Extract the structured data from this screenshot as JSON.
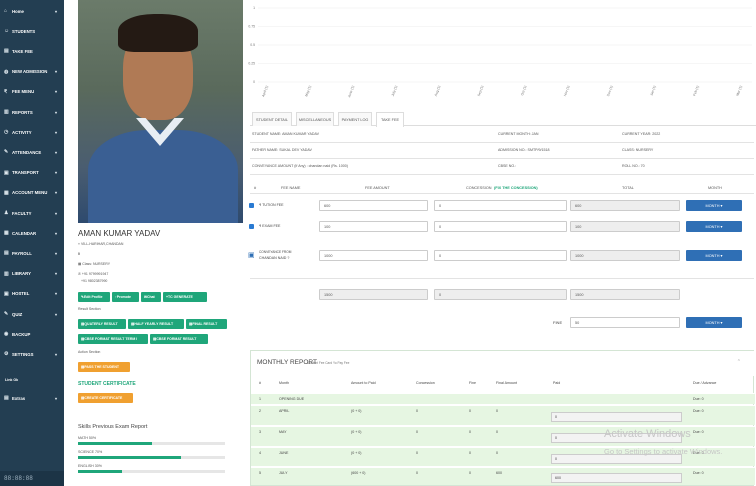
{
  "sidebar": {
    "items": [
      {
        "label": "Home",
        "icon": "home-icon",
        "glyph": "⌂",
        "arrow": true
      },
      {
        "label": "STUDENTS",
        "icon": "users-icon",
        "glyph": "☺",
        "arrow": false
      },
      {
        "label": "TAKE FEE",
        "icon": "fee-icon",
        "glyph": "▤",
        "arrow": false
      },
      {
        "label": "NEW ADMISSION",
        "icon": "globe-icon",
        "glyph": "◍",
        "arrow": true
      },
      {
        "label": "FEE MENU",
        "icon": "rupee-icon",
        "glyph": "₹",
        "arrow": true
      },
      {
        "label": "REPORTS",
        "icon": "chart-icon",
        "glyph": "▥",
        "arrow": true
      },
      {
        "label": "ACTIVITY",
        "icon": "activity-icon",
        "glyph": "◷",
        "arrow": true
      },
      {
        "label": "ATTENDANCE",
        "icon": "attendance-icon",
        "glyph": "✎",
        "arrow": true
      },
      {
        "label": "TRANSPORT",
        "icon": "bus-icon",
        "glyph": "▣",
        "arrow": true
      },
      {
        "label": "ACCOUNT MENU",
        "icon": "account-icon",
        "glyph": "▦",
        "arrow": true
      },
      {
        "label": "FACULTY",
        "icon": "faculty-icon",
        "glyph": "♟",
        "arrow": true
      },
      {
        "label": "CALENDAR",
        "icon": "calendar-icon",
        "glyph": "▦",
        "arrow": true
      },
      {
        "label": "PAYROLL",
        "icon": "payroll-icon",
        "glyph": "▤",
        "arrow": true
      },
      {
        "label": "LIBRARY",
        "icon": "library-icon",
        "glyph": "▥",
        "arrow": true
      },
      {
        "label": "HOSTEL",
        "icon": "hostel-icon",
        "glyph": "▣",
        "arrow": true
      },
      {
        "label": "QUIZ",
        "icon": "quiz-icon",
        "glyph": "✎",
        "arrow": true
      },
      {
        "label": "BACKUP",
        "icon": "backup-icon",
        "glyph": "◉",
        "arrow": false
      },
      {
        "label": "SETTINGS",
        "icon": "settings-icon",
        "glyph": "⚙",
        "arrow": true
      }
    ],
    "section_label": "Link Ok",
    "extra_item": {
      "label": "Extras",
      "icon": "extras-icon",
      "glyph": "▤"
    },
    "footer": "88:88:88"
  },
  "student": {
    "name": "AMAN KUMAR YADAV",
    "village": "VILL-HARIHAR,CHANDAN",
    "marker": "0",
    "class": "Class: NURSERY",
    "phone1": "+91 9799991947",
    "phone2": "+91 9802387990"
  },
  "actions": {
    "edit": "Edit Profile",
    "promote": "Promote",
    "chat": "Chat",
    "tc": "TC GENERATE"
  },
  "result_section": {
    "label": "Result Section",
    "quarterly": "QUATERLY RESULT",
    "half": "HALF YEARLY RESULT",
    "final": "FINAL RESULT",
    "cbse_term": "CBSE FORMAT RESULT TERM I",
    "cbse": "CBSE FORMAT RESULT"
  },
  "action_section": {
    "label": "Action Section",
    "pass": "PASS THE STUDENT"
  },
  "certificate": {
    "title": "STUDENT CERTIFICATE",
    "button": "CREATE CERTIFICATE"
  },
  "skills": {
    "title": "Skills Previous Exam Report",
    "items": [
      {
        "label": "MATH 50%",
        "value": 50
      },
      {
        "label": "SCIENCE 70%",
        "value": 70
      },
      {
        "label": "ENGLISH 30%",
        "value": 30
      }
    ]
  },
  "chart_data": {
    "type": "line",
    "yticks": [
      "1",
      "0.75",
      "0.5",
      "0.25",
      "0"
    ],
    "categories": [
      "April (1)",
      "May (1)",
      "June (1)",
      "July (1)",
      "Aug (1)",
      "Sep (1)",
      "Oct (1)",
      "Nov (1)",
      "Dec (1)",
      "Jan (1)",
      "Feb (1)",
      "Mar (1)"
    ],
    "ylim": [
      0,
      1
    ]
  },
  "tabs": [
    {
      "label": "STUDENT DETAIL",
      "active": false
    },
    {
      "label": "MISCELLANEOUS",
      "active": false
    },
    {
      "label": "PAYMENT LOG",
      "active": false
    },
    {
      "label": "TAKE FEE",
      "active": true
    }
  ],
  "details": {
    "student_name": "STUDENT NAME: AMAN KUMAR YADAV",
    "current_month": "CURRENT MONTH: JAN",
    "current_year": "CURRENT YEAR: 2022",
    "father_name": "FATHER NAME: SUKAL DEV YADAV",
    "admission_no": "ADMISSION NO.: SMTP/9/1518",
    "class": "CLASS: NURSERY",
    "conveyance": "CONVEYANCE AMOUNT (If Any) : chandan naid (Rs. 1000)",
    "cbse_no": "CBSE NO.:",
    "roll_no": "ROLL NO.: 70"
  },
  "fee_table": {
    "headers": {
      "hash": "#",
      "name": "FEE NAME",
      "amount": "FEE AMOUNT",
      "concession": "CONCESSION",
      "concession_note": "(FIX THE CONCESSION)",
      "total": "TOTAL",
      "month": "MONTH"
    },
    "rows": [
      {
        "name": "₹ TUTION FEE",
        "amount": "600",
        "concession": "0",
        "total": "600",
        "month": "MONTH ▾"
      },
      {
        "name": "₹ EXAM FEE",
        "amount": "100",
        "concession": "0",
        "total": "100",
        "month": "MONTH ▾"
      }
    ],
    "conveyance_row": {
      "name1": "CONVEYANCE FROM",
      "name2": "CHANDAN NAID ?",
      "amount": "1000",
      "concession": "0",
      "total": "1000",
      "month": "MONTH ▾"
    },
    "totals": {
      "amount": "1500",
      "concession": "0",
      "total": "1500"
    },
    "fine": {
      "label": "FINE",
      "value": "50",
      "month": "MONTH ▾"
    }
  },
  "monthly": {
    "title": "MONTHLY REPORT",
    "subtitle": "Student Fee Card Yo Pay Fee",
    "columns": [
      "#",
      "Month",
      "Amount to Paid",
      "Concession",
      "Fine",
      "Final Amount",
      "Paid",
      "Due / Advance"
    ],
    "rows": [
      {
        "n": "1",
        "month": "OPENING DUE",
        "amount": "",
        "conc": "",
        "fine": "",
        "final": "",
        "paid": "",
        "due": "Due: 0"
      },
      {
        "n": "2",
        "month": "APRIL",
        "amount": "(0 + 0)",
        "conc": "0",
        "fine": "0",
        "final": "0",
        "paid": "0",
        "due": "Due: 0"
      },
      {
        "n": "3",
        "month": "MAY",
        "amount": "(0 + 0)",
        "conc": "0",
        "fine": "0",
        "final": "0",
        "paid": "0",
        "due": "Due: 0"
      },
      {
        "n": "4",
        "month": "JUNE",
        "amount": "(0 + 0)",
        "conc": "0",
        "fine": "0",
        "final": "0",
        "paid": "0",
        "due": "Due: 0"
      },
      {
        "n": "5",
        "month": "JULY",
        "amount": "(600 + 0)",
        "conc": "0",
        "fine": "0",
        "final": "600",
        "paid": "600",
        "due": "Due: 0"
      }
    ]
  },
  "watermark": {
    "line1": "Activate Windows",
    "line2": "Go to Settings to activate Windows."
  }
}
